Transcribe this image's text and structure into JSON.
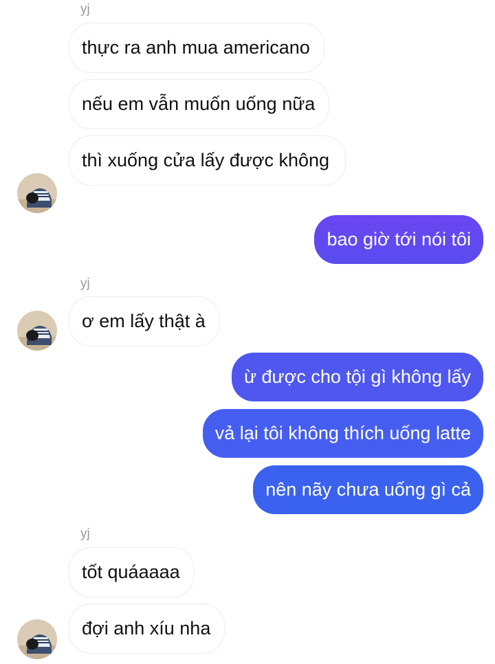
{
  "conversation": {
    "contact_name": "yj",
    "messages": [
      {
        "from": "them",
        "text": "thực ra anh mua americano"
      },
      {
        "from": "them",
        "text": "nếu em vẫn muốn uống nữa"
      },
      {
        "from": "them",
        "text": "thì xuống cửa lấy được không"
      },
      {
        "from": "me",
        "text": "bao giờ tới nói tôi"
      },
      {
        "from": "them",
        "text": "ơ em lấy thật à"
      },
      {
        "from": "me",
        "text": "ừ được cho tội gì không lấy"
      },
      {
        "from": "me",
        "text": "vả lại tôi không thích uống latte"
      },
      {
        "from": "me",
        "text": "nên nãy chưa uống gì cả"
      },
      {
        "from": "them",
        "text": "tốt quáaaaa"
      },
      {
        "from": "them",
        "text": "đợi anh xíu nha"
      }
    ]
  },
  "colors": {
    "outgoing_gradient_top": "#7a3ff0",
    "outgoing_gradient_bottom": "#2f60ee",
    "incoming_bg": "#ffffff",
    "sender_label": "#9a9a9a"
  },
  "icons": {
    "avatar": "contact-avatar-photo"
  }
}
